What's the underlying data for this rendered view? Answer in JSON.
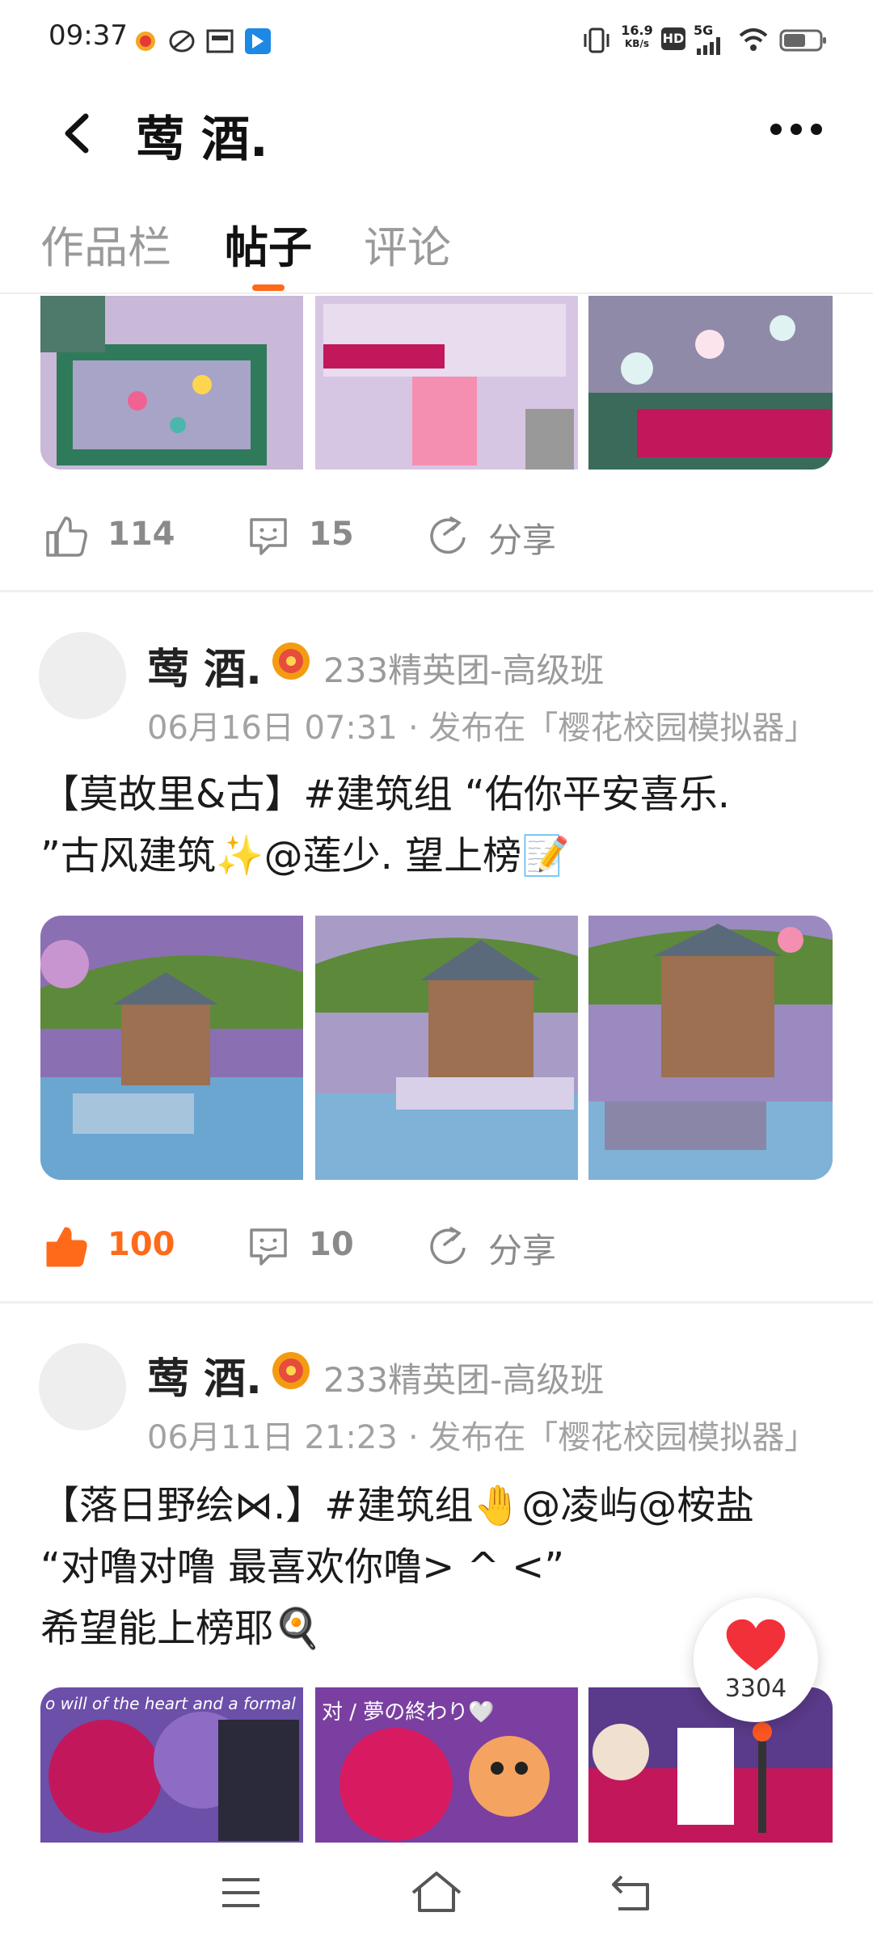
{
  "status_bar": {
    "time": "09:37",
    "net_speed_value": "16.9",
    "net_speed_unit": "KB/s",
    "hd": "HD",
    "network": "5G"
  },
  "header": {
    "title": "莺 酒.",
    "back_icon": "chevron-left-icon",
    "more_icon": "more-horizontal-icon"
  },
  "tabs": [
    {
      "label": "作品栏",
      "active": false
    },
    {
      "label": "帖子",
      "active": true
    },
    {
      "label": "评论",
      "active": false
    }
  ],
  "accent_color": "#ff6a1a",
  "posts": [
    {
      "likes": "114",
      "liked": false,
      "comments": "15",
      "share_label": "分享"
    },
    {
      "author": "莺 酒.",
      "group": "233精英团-高级班",
      "timestamp": "06月16日 07:31",
      "published_in": "· 发布在「樱花校园模拟器」",
      "content_line1": "【莫故里&古】#建筑组 “佑你平安喜乐.",
      "content_line2": "”古风建筑✨@莲少.  望上榜📝",
      "likes": "100",
      "liked": true,
      "comments": "10",
      "share_label": "分享"
    },
    {
      "author": "莺 酒.",
      "group": "233精英团-高级班",
      "timestamp": "06月11日 21:23",
      "published_in": "· 发布在「樱花校园模拟器」",
      "content_line1": "【落日野绘⋈.】#建筑组🤚@凌屿@桉盐",
      "content_line2": "“对噜对噜 最喜欢你噜> ^ <”",
      "content_line3": "希望能上榜耶🍳",
      "image_caption_1": "o will of the heart and a formal",
      "image_caption_2": "对 / 夢の終わり🤍"
    }
  ],
  "floating_like": {
    "count": "3304",
    "icon": "heart-icon"
  },
  "nav_bar": {
    "icons": [
      "menu-icon",
      "home-icon",
      "back-icon"
    ]
  }
}
